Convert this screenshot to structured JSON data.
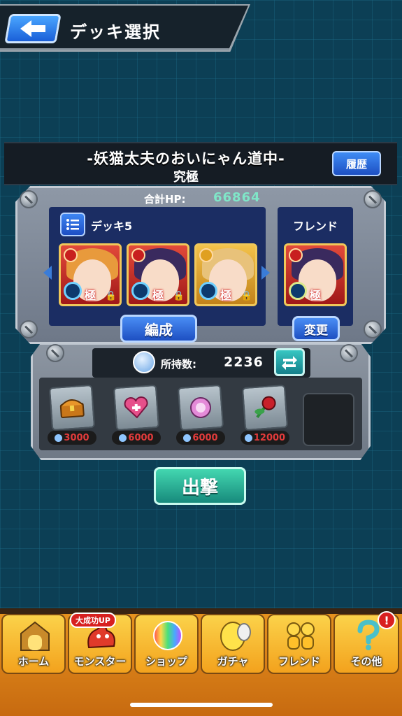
{
  "header": {
    "title": "デッキ選択"
  },
  "quest": {
    "title": "-妖猫太夫のおいにゃん道中-",
    "difficulty": "究極",
    "history_label": "履歴"
  },
  "deck": {
    "hp_label": "合計HP:",
    "hp_value": "66864",
    "deck_name": "デッキ5",
    "friend_label": "フレンド",
    "edit_label": "編成",
    "change_label": "変更",
    "kiwami_label": "極",
    "monsters": [
      {
        "hair": "#e89a3c",
        "accent": "#e03a3a"
      },
      {
        "hair": "#3a2a5e",
        "accent": "#e03a3a"
      },
      {
        "hair": "#e8c27a",
        "accent": "#f0a020"
      }
    ],
    "friend_monster": {
      "hair": "#3a2a5e",
      "accent": "#e03a3a"
    }
  },
  "items": {
    "owned_label": "所持数:",
    "owned_value": "2236",
    "slots": [
      {
        "icon": "treasure-chest-icon",
        "cost": "3000"
      },
      {
        "icon": "heart-icon",
        "cost": "6000"
      },
      {
        "icon": "sparkle-orb-icon",
        "cost": "6000"
      },
      {
        "icon": "rose-icon",
        "cost": "12000"
      }
    ]
  },
  "sortie_label": "出撃",
  "nav": {
    "badge": "大成功UP",
    "alert": "!",
    "items": [
      {
        "label": "ホーム",
        "icon": "home-gate-icon"
      },
      {
        "label": "モンスター",
        "icon": "dragon-icon"
      },
      {
        "label": "ショップ",
        "icon": "rainbow-orb-icon"
      },
      {
        "label": "ガチャ",
        "icon": "egg-icon"
      },
      {
        "label": "フレンド",
        "icon": "friends-icon"
      },
      {
        "label": "その他",
        "icon": "question-icon"
      }
    ]
  }
}
